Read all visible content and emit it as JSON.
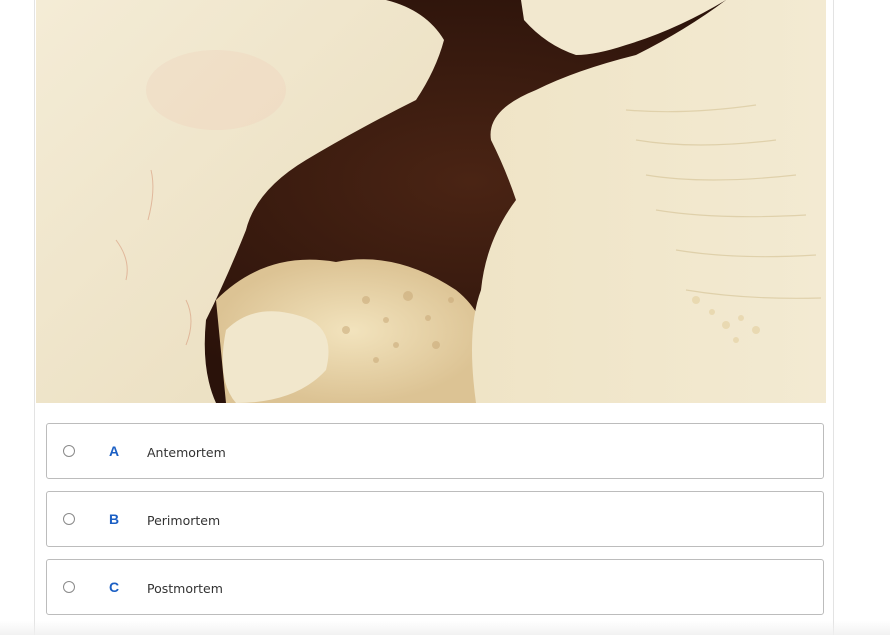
{
  "question": {
    "image": {
      "name": "bone-photo"
    },
    "options": [
      {
        "letter": "A",
        "label": "Antemortem"
      },
      {
        "letter": "B",
        "label": "Perimortem"
      },
      {
        "letter": "C",
        "label": "Postmortem"
      }
    ]
  },
  "colors": {
    "accent": "#1b5fc4",
    "option_border": "#bcbcbc",
    "text": "#333333"
  }
}
